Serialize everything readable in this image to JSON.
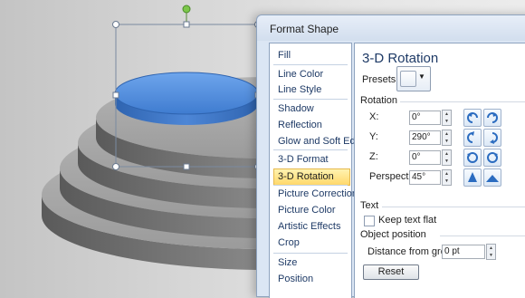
{
  "dialog": {
    "title": "Format Shape",
    "nav": {
      "items": [
        {
          "label": "Fill"
        },
        {
          "label": "Line Color"
        },
        {
          "label": "Line Style"
        },
        {
          "label": "Shadow"
        },
        {
          "label": "Reflection"
        },
        {
          "label": "Glow and Soft Edges"
        },
        {
          "label": "3-D Format"
        },
        {
          "label": "3-D Rotation",
          "selected": true
        },
        {
          "label": "Picture Corrections"
        },
        {
          "label": "Picture Color"
        },
        {
          "label": "Artistic Effects"
        },
        {
          "label": "Crop"
        },
        {
          "label": "Size"
        },
        {
          "label": "Position"
        }
      ]
    },
    "panel": {
      "title": "3-D Rotation",
      "presets_label": "Presets:",
      "rotation_header": "Rotation",
      "x_label": "X:",
      "x_value": "0°",
      "y_label": "Y:",
      "y_value": "290°",
      "z_label": "Z:",
      "z_value": "0°",
      "perspective_label": "Perspective:",
      "perspective_value": "45°",
      "text_header": "Text",
      "keep_flat_label": "Keep text flat",
      "object_position_header": "Object position",
      "distance_label": "Distance from ground:",
      "distance_value": "0 pt",
      "reset_label": "Reset"
    }
  },
  "colors": {
    "disc_blue": "#4f8ad8",
    "step_gray": "#9a9a9a",
    "selection_handle_green": "#6dbb3b",
    "nav_selected": "#ffd86b"
  }
}
